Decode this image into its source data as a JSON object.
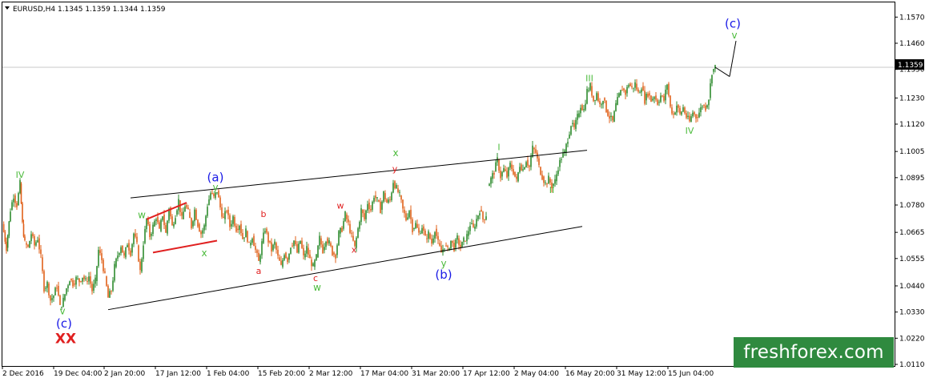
{
  "header": {
    "symbol_line": "EURUSD,H4  1.1345 1.1359 1.1344 1.1359"
  },
  "watermark": "freshforex.com",
  "chart_data": {
    "type": "candlestick",
    "symbol": "EURUSD",
    "timeframe": "H4",
    "ohlc_last": {
      "open": 1.1345,
      "high": 1.1359,
      "low": 1.1344,
      "close": 1.1359
    },
    "current_price_label": "1.1359",
    "price_line": 1.1359,
    "ylim": [
      1.011,
      1.1625
    ],
    "yticks": [
      "1.1570",
      "1.1460",
      "1.1350",
      "1.1230",
      "1.1120",
      "1.1005",
      "1.0895",
      "1.0780",
      "1.0665",
      "1.0555",
      "1.0440",
      "1.0330",
      "1.0220",
      "1.0110"
    ],
    "xticks": [
      "2 Dec 2016",
      "19 Dec 04:00",
      "2 Jan 20:00",
      "17 Jan 12:00",
      "1 Feb 04:00",
      "15 Feb 20:00",
      "2 Mar 12:00",
      "17 Mar 04:00",
      "31 Mar 20:00",
      "17 Apr 12:00",
      "2 May 04:00",
      "16 May 20:00",
      "31 May 12:00",
      "15 Jun 04:00"
    ],
    "colors": {
      "up": "#2e8b2e",
      "down": "#e0601a",
      "wave_green": "#4cbb3c",
      "wave_red": "#e02020",
      "wave_blue": "#1a1ae6",
      "line": "#000000"
    },
    "price_path": [
      [
        0,
        1.07
      ],
      [
        5,
        1.06
      ],
      [
        10,
        1.076
      ],
      [
        14,
        1.082
      ],
      [
        18,
        1.078
      ],
      [
        22,
        1.087
      ],
      [
        25,
        1.07
      ],
      [
        28,
        1.062
      ],
      [
        32,
        1.06
      ],
      [
        36,
        1.066
      ],
      [
        40,
        1.061
      ],
      [
        44,
        1.064
      ],
      [
        48,
        1.056
      ],
      [
        52,
        1.043
      ],
      [
        56,
        1.045
      ],
      [
        60,
        1.038
      ],
      [
        64,
        1.04
      ],
      [
        68,
        1.044
      ],
      [
        72,
        1.035
      ],
      [
        76,
        1.038
      ],
      [
        80,
        1.043
      ],
      [
        84,
        1.047
      ],
      [
        88,
        1.045
      ],
      [
        92,
        1.047
      ],
      [
        96,
        1.046
      ],
      [
        100,
        1.048
      ],
      [
        104,
        1.046
      ],
      [
        108,
        1.048
      ],
      [
        112,
        1.042
      ],
      [
        116,
        1.046
      ],
      [
        120,
        1.059
      ],
      [
        124,
        1.055
      ],
      [
        128,
        1.048
      ],
      [
        132,
        1.039
      ],
      [
        136,
        1.042
      ],
      [
        140,
        1.052
      ],
      [
        144,
        1.057
      ],
      [
        148,
        1.061
      ],
      [
        152,
        1.056
      ],
      [
        156,
        1.062
      ],
      [
        160,
        1.058
      ],
      [
        164,
        1.066
      ],
      [
        168,
        1.061
      ],
      [
        172,
        1.05
      ],
      [
        176,
        1.062
      ],
      [
        180,
        1.072
      ],
      [
        184,
        1.065
      ],
      [
        188,
        1.069
      ],
      [
        192,
        1.073
      ],
      [
        196,
        1.067
      ],
      [
        200,
        1.074
      ],
      [
        204,
        1.066
      ],
      [
        208,
        1.077
      ],
      [
        212,
        1.069
      ],
      [
        216,
        1.074
      ],
      [
        220,
        1.08
      ],
      [
        224,
        1.072
      ],
      [
        228,
        1.078
      ],
      [
        232,
        1.075
      ],
      [
        236,
        1.069
      ],
      [
        240,
        1.076
      ],
      [
        244,
        1.07
      ],
      [
        248,
        1.066
      ],
      [
        252,
        1.069
      ],
      [
        256,
        1.078
      ],
      [
        260,
        1.083
      ],
      [
        264,
        1.081
      ],
      [
        268,
        1.084
      ],
      [
        272,
        1.077
      ],
      [
        276,
        1.072
      ],
      [
        280,
        1.076
      ],
      [
        284,
        1.069
      ],
      [
        288,
        1.073
      ],
      [
        292,
        1.068
      ],
      [
        296,
        1.07
      ],
      [
        300,
        1.064
      ],
      [
        304,
        1.067
      ],
      [
        308,
        1.061
      ],
      [
        312,
        1.065
      ],
      [
        316,
        1.059
      ],
      [
        320,
        1.054
      ],
      [
        324,
        1.062
      ],
      [
        328,
        1.068
      ],
      [
        332,
        1.063
      ],
      [
        336,
        1.059
      ],
      [
        340,
        1.062
      ],
      [
        344,
        1.056
      ],
      [
        348,
        1.052
      ],
      [
        352,
        1.058
      ],
      [
        356,
        1.055
      ],
      [
        360,
        1.061
      ],
      [
        364,
        1.063
      ],
      [
        368,
        1.058
      ],
      [
        372,
        1.063
      ],
      [
        376,
        1.056
      ],
      [
        380,
        1.06
      ],
      [
        384,
        1.055
      ],
      [
        388,
        1.052
      ],
      [
        392,
        1.056
      ],
      [
        396,
        1.064
      ],
      [
        400,
        1.059
      ],
      [
        404,
        1.064
      ],
      [
        408,
        1.062
      ],
      [
        412,
        1.058
      ],
      [
        416,
        1.057
      ],
      [
        420,
        1.066
      ],
      [
        424,
        1.068
      ],
      [
        428,
        1.074
      ],
      [
        432,
        1.07
      ],
      [
        436,
        1.065
      ],
      [
        440,
        1.06
      ],
      [
        444,
        1.068
      ],
      [
        448,
        1.076
      ],
      [
        452,
        1.072
      ],
      [
        456,
        1.079
      ],
      [
        460,
        1.076
      ],
      [
        464,
        1.082
      ],
      [
        468,
        1.08
      ],
      [
        472,
        1.076
      ],
      [
        476,
        1.083
      ],
      [
        480,
        1.079
      ],
      [
        484,
        1.08
      ],
      [
        488,
        1.088
      ],
      [
        492,
        1.085
      ],
      [
        496,
        1.082
      ],
      [
        500,
        1.076
      ],
      [
        504,
        1.072
      ],
      [
        508,
        1.076
      ],
      [
        512,
        1.068
      ],
      [
        516,
        1.07
      ],
      [
        520,
        1.066
      ],
      [
        524,
        1.069
      ],
      [
        528,
        1.064
      ],
      [
        532,
        1.066
      ],
      [
        536,
        1.062
      ],
      [
        540,
        1.068
      ],
      [
        544,
        1.062
      ],
      [
        548,
        1.058
      ],
      [
        552,
        1.061
      ],
      [
        556,
        1.059
      ],
      [
        560,
        1.063
      ],
      [
        564,
        1.06
      ],
      [
        568,
        1.064
      ],
      [
        572,
        1.06
      ],
      [
        576,
        1.063
      ],
      [
        580,
        1.065
      ],
      [
        584,
        1.07
      ],
      [
        588,
        1.068
      ],
      [
        592,
        1.072
      ],
      [
        596,
        1.076
      ],
      [
        600,
        1.072
      ],
      [
        604,
        1.074
      ],
      null,
      [
        606,
        1.086
      ],
      [
        610,
        1.089
      ],
      [
        614,
        1.092
      ],
      [
        618,
        1.097
      ],
      [
        622,
        1.09
      ],
      [
        626,
        1.093
      ],
      [
        630,
        1.09
      ],
      [
        634,
        1.095
      ],
      [
        638,
        1.092
      ],
      [
        642,
        1.088
      ],
      [
        646,
        1.095
      ],
      [
        650,
        1.093
      ],
      [
        654,
        1.097
      ],
      [
        658,
        1.094
      ],
      [
        662,
        1.102
      ],
      [
        666,
        1.1
      ],
      [
        670,
        1.094
      ],
      [
        674,
        1.09
      ],
      [
        678,
        1.087
      ],
      [
        682,
        1.089
      ],
      [
        686,
        1.086
      ],
      [
        690,
        1.088
      ],
      [
        694,
        1.094
      ],
      [
        698,
        1.098
      ],
      [
        702,
        1.1
      ],
      [
        706,
        1.106
      ],
      [
        710,
        1.112
      ],
      [
        714,
        1.11
      ],
      [
        718,
        1.115
      ],
      [
        722,
        1.12
      ],
      [
        726,
        1.118
      ],
      [
        730,
        1.126
      ],
      [
        734,
        1.128
      ],
      [
        738,
        1.122
      ],
      [
        742,
        1.125
      ],
      [
        746,
        1.12
      ],
      [
        750,
        1.123
      ],
      [
        754,
        1.118
      ],
      [
        758,
        1.115
      ],
      [
        762,
        1.113
      ],
      [
        766,
        1.12
      ],
      [
        770,
        1.124
      ],
      [
        774,
        1.127
      ],
      [
        778,
        1.125
      ],
      [
        782,
        1.129
      ],
      [
        786,
        1.127
      ],
      [
        790,
        1.129
      ],
      [
        794,
        1.125
      ],
      [
        798,
        1.128
      ],
      [
        802,
        1.122
      ],
      [
        806,
        1.125
      ],
      [
        810,
        1.122
      ],
      [
        814,
        1.124
      ],
      [
        818,
        1.121
      ],
      [
        822,
        1.124
      ],
      [
        826,
        1.122
      ],
      [
        830,
        1.129
      ],
      [
        834,
        1.119
      ],
      [
        838,
        1.116
      ],
      [
        842,
        1.12
      ],
      [
        846,
        1.116
      ],
      [
        850,
        1.119
      ],
      [
        854,
        1.115
      ],
      [
        858,
        1.113
      ],
      [
        862,
        1.117
      ],
      [
        866,
        1.115
      ],
      [
        870,
        1.117
      ],
      [
        874,
        1.12
      ],
      [
        878,
        1.119
      ],
      [
        882,
        1.123
      ],
      [
        886,
        1.134
      ],
      [
        890,
        1.1359
      ]
    ],
    "trend_lines": [
      {
        "name": "channel-upper",
        "from": [
          160,
          1.081
        ],
        "to": [
          730,
          1.101
        ],
        "color": "#000000"
      },
      {
        "name": "channel-lower",
        "from": [
          132,
          1.034
        ],
        "to": [
          724,
          1.069
        ],
        "color": "#000000"
      },
      {
        "name": "triangle-top",
        "from": [
          180,
          1.072
        ],
        "to": [
          230,
          1.079
        ],
        "color": "#e02020"
      },
      {
        "name": "triangle-bottom",
        "from": [
          188,
          1.058
        ],
        "to": [
          268,
          1.063
        ],
        "color": "#e02020"
      },
      {
        "name": "forecast",
        "from": [
          890,
          1.1359
        ],
        "to": [
          908,
          1.132
        ],
        "color": "#000000"
      },
      {
        "name": "forecast-2",
        "from": [
          908,
          1.132
        ],
        "to": [
          916,
          1.147
        ],
        "color": "#000000"
      }
    ],
    "annotations": [
      {
        "text": "IV",
        "x": 22,
        "y": 1.0895,
        "color": "#4cbb3c",
        "size": 11
      },
      {
        "text": "v",
        "x": 75,
        "y": 1.032,
        "color": "#4cbb3c",
        "size": 12
      },
      {
        "text": "(c)",
        "x": 77,
        "y": 1.0265,
        "color": "#1a1ae6",
        "size": 15
      },
      {
        "text": "XX",
        "x": 79,
        "y": 1.02,
        "color": "#e02020",
        "size": 17,
        "bold": true
      },
      {
        "text": "w",
        "x": 174,
        "y": 1.0725,
        "color": "#4cbb3c",
        "size": 12
      },
      {
        "text": "x",
        "x": 252,
        "y": 1.0565,
        "color": "#4cbb3c",
        "size": 12
      },
      {
        "text": "y",
        "x": 266,
        "y": 1.084,
        "color": "#4cbb3c",
        "size": 12
      },
      {
        "text": "(a)",
        "x": 266,
        "y": 1.088,
        "color": "#1a1ae6",
        "size": 15
      },
      {
        "text": "a",
        "x": 320,
        "y": 1.049,
        "color": "#e02020",
        "size": 11
      },
      {
        "text": "b",
        "x": 326,
        "y": 1.073,
        "color": "#e02020",
        "size": 11
      },
      {
        "text": "c",
        "x": 391,
        "y": 1.046,
        "color": "#e02020",
        "size": 11
      },
      {
        "text": "w",
        "x": 393,
        "y": 1.042,
        "color": "#4cbb3c",
        "size": 12
      },
      {
        "text": "w",
        "x": 422,
        "y": 1.0765,
        "color": "#e02020",
        "size": 11
      },
      {
        "text": "x",
        "x": 439,
        "y": 1.058,
        "color": "#e02020",
        "size": 11
      },
      {
        "text": "x",
        "x": 491,
        "y": 1.0985,
        "color": "#4cbb3c",
        "size": 12
      },
      {
        "text": "y",
        "x": 490,
        "y": 1.092,
        "color": "#e02020",
        "size": 11
      },
      {
        "text": "y",
        "x": 551,
        "y": 1.052,
        "color": "#4cbb3c",
        "size": 12
      },
      {
        "text": "(b)",
        "x": 551,
        "y": 1.047,
        "color": "#1a1ae6",
        "size": 15
      },
      {
        "text": "I",
        "x": 620,
        "y": 1.101,
        "color": "#4cbb3c",
        "size": 11
      },
      {
        "text": "II",
        "x": 686,
        "y": 1.083,
        "color": "#4cbb3c",
        "size": 11
      },
      {
        "text": "III",
        "x": 733,
        "y": 1.13,
        "color": "#4cbb3c",
        "size": 11
      },
      {
        "text": "IV",
        "x": 858,
        "y": 1.108,
        "color": "#4cbb3c",
        "size": 11
      },
      {
        "text": "(c)",
        "x": 912,
        "y": 1.1525,
        "color": "#1a1ae6",
        "size": 15
      },
      {
        "text": "v",
        "x": 914,
        "y": 1.148,
        "color": "#4cbb3c",
        "size": 12
      }
    ]
  }
}
